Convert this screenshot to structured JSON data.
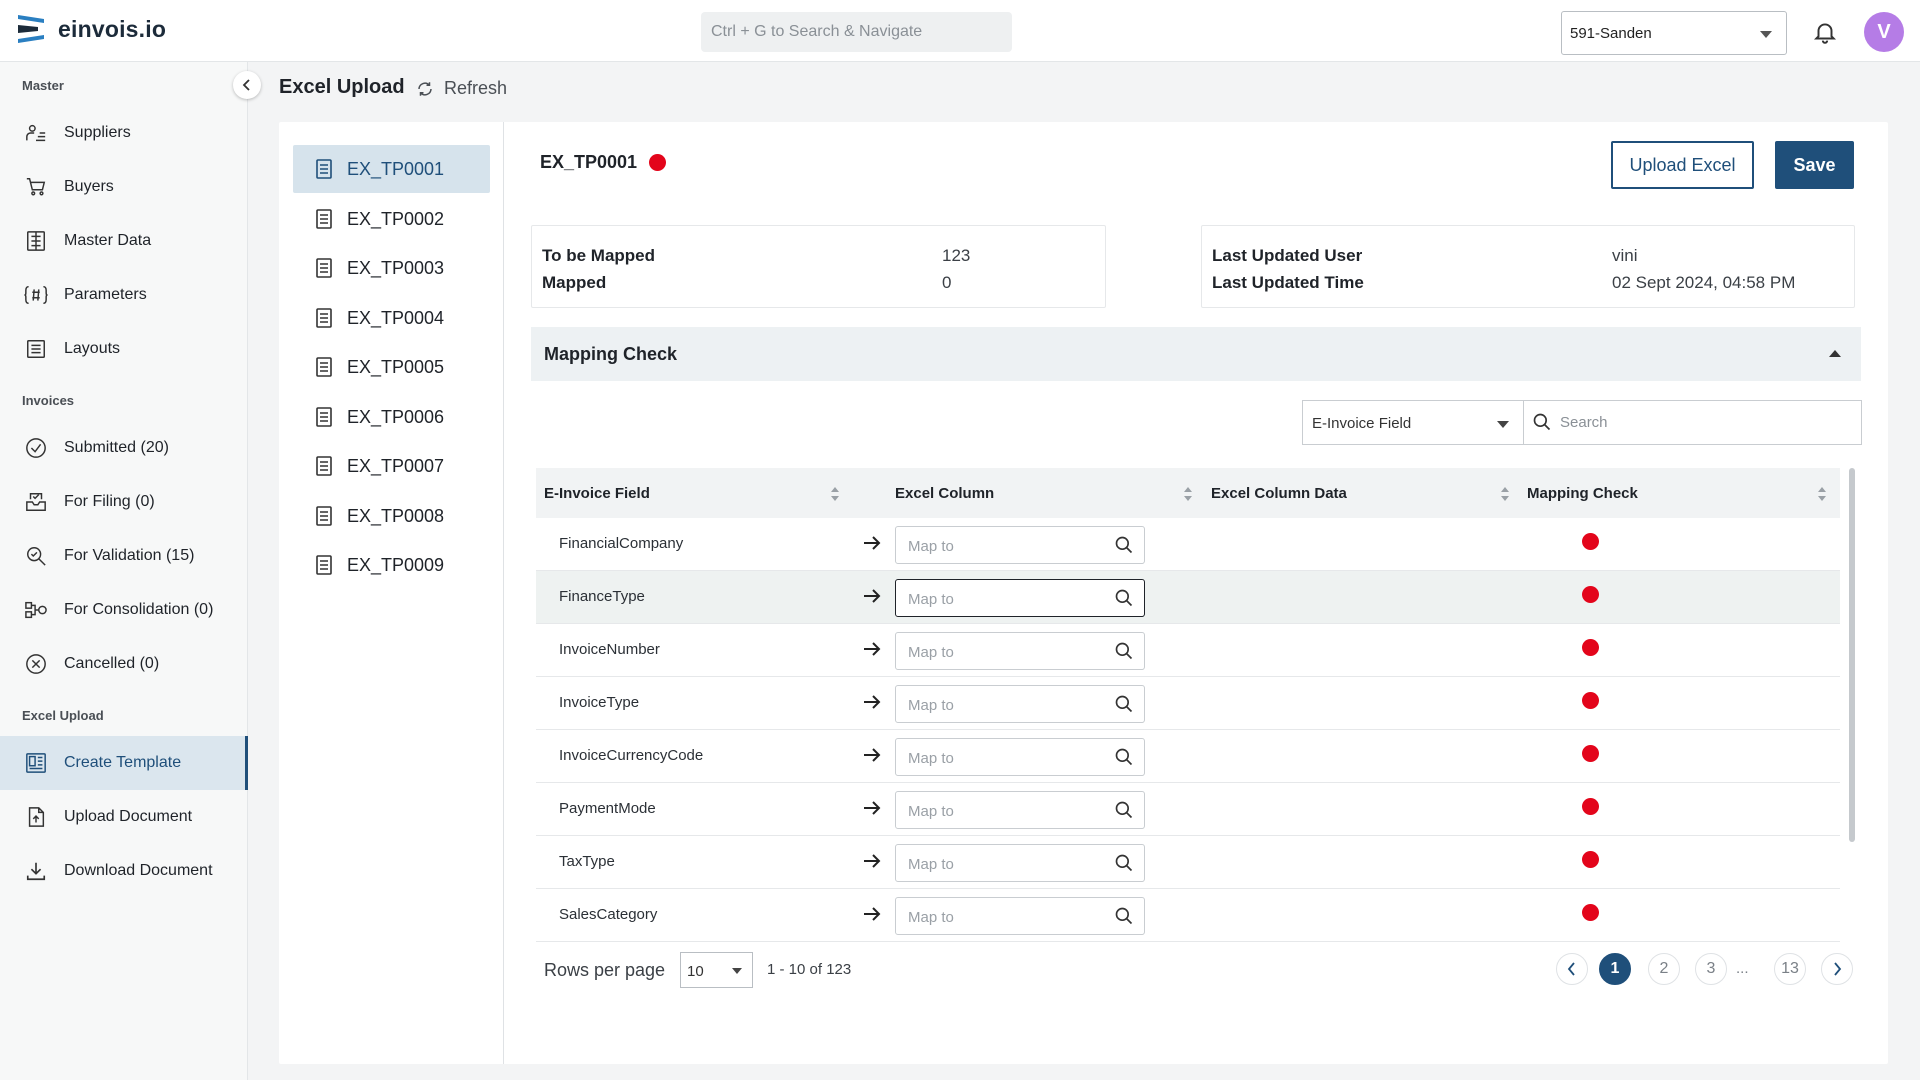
{
  "app": {
    "name": "einvois.io"
  },
  "topbar": {
    "search_placeholder": "Ctrl + G to Search & Navigate",
    "company": "591-Sanden",
    "avatar_initial": "V"
  },
  "sidebar": {
    "sections": [
      {
        "label": "Master"
      },
      {
        "label": "Invoices"
      },
      {
        "label": "Excel Upload"
      }
    ],
    "items": [
      {
        "label": "Suppliers",
        "icon": "suppliers-icon"
      },
      {
        "label": "Buyers",
        "icon": "cart-icon"
      },
      {
        "label": "Master Data",
        "icon": "master-data-icon"
      },
      {
        "label": "Parameters",
        "icon": "parameters-icon"
      },
      {
        "label": "Layouts",
        "icon": "layouts-icon"
      },
      {
        "label": "Submitted (20)",
        "icon": "check-circle-icon"
      },
      {
        "label": "For Filing (0)",
        "icon": "filing-icon"
      },
      {
        "label": "For Validation (15)",
        "icon": "validation-search-icon"
      },
      {
        "label": "For Consolidation (0)",
        "icon": "consolidation-icon"
      },
      {
        "label": "Cancelled (0)",
        "icon": "cancel-circle-icon"
      },
      {
        "label": "Create Template",
        "icon": "template-icon",
        "active": true
      },
      {
        "label": "Upload Document",
        "icon": "upload-document-icon"
      },
      {
        "label": "Download Document",
        "icon": "download-icon"
      }
    ]
  },
  "page": {
    "title": "Excel Upload",
    "refresh_label": "Refresh"
  },
  "templates": [
    "EX_TP0001",
    "EX_TP0002",
    "EX_TP0003",
    "EX_TP0004",
    "EX_TP0005",
    "EX_TP0006",
    "EX_TP0007",
    "EX_TP0008",
    "EX_TP0009"
  ],
  "detail": {
    "title": "EX_TP0001",
    "upload_label": "Upload Excel",
    "save_label": "Save",
    "stats_left": [
      {
        "label": "To be Mapped",
        "value": "123"
      },
      {
        "label": "Mapped",
        "value": "0"
      }
    ],
    "stats_right": [
      {
        "label": "Last Updated User",
        "value": "vini"
      },
      {
        "label": "Last Updated Time",
        "value": "02 Sept 2024, 04:58 PM"
      }
    ],
    "section_title": "Mapping Check",
    "filter_selected": "E-Invoice Field",
    "search_placeholder": "Search"
  },
  "table": {
    "headers": [
      "E-Invoice Field",
      "Excel Column",
      "Excel Column Data",
      "Mapping Check"
    ],
    "map_placeholder": "Map to",
    "status_color": "#e3051b",
    "rows": [
      {
        "field": "FinancialCompany"
      },
      {
        "field": "FinanceType"
      },
      {
        "field": "InvoiceNumber"
      },
      {
        "field": "InvoiceType"
      },
      {
        "field": "InvoiceCurrencyCode"
      },
      {
        "field": "PaymentMode"
      },
      {
        "field": "TaxType"
      },
      {
        "field": "SalesCategory"
      }
    ]
  },
  "pagination": {
    "rows_per_page_label": "Rows per page",
    "rows_per_page": "10",
    "range": "1 - 10 of 123",
    "pages": [
      "1",
      "2",
      "3",
      "13"
    ],
    "ellipsis": "...",
    "current": "1"
  },
  "colors": {
    "primary": "#1f4f7a",
    "accent_avatar": "#b57ce6",
    "status_unmapped": "#e3051b"
  }
}
